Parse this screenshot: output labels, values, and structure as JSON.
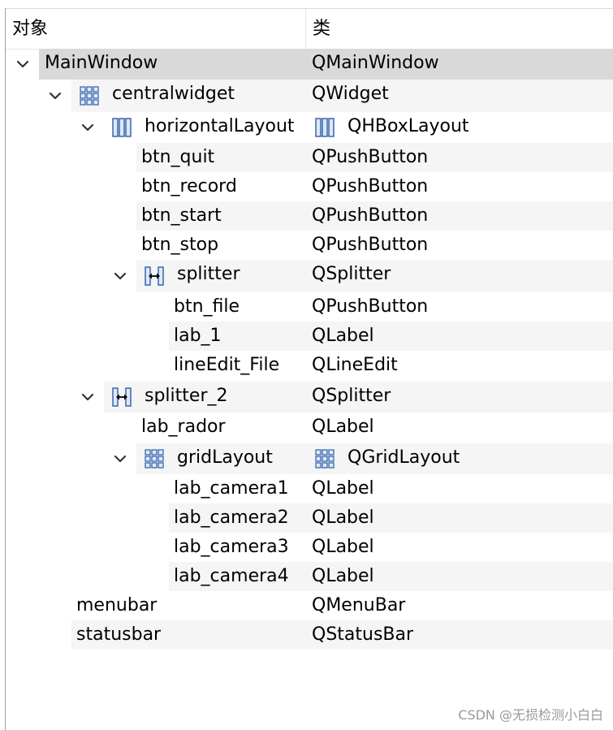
{
  "header": {
    "object_col": "对象",
    "class_col": "类"
  },
  "rows": [
    {
      "name": "MainWindow",
      "cls": "QMainWindow",
      "depth": 0,
      "expand": true,
      "icon": "",
      "cls_icon": "",
      "selected": true
    },
    {
      "name": "centralwidget",
      "cls": "QWidget",
      "depth": 1,
      "expand": true,
      "icon": "grid-layout-icon",
      "cls_icon": ""
    },
    {
      "name": "horizontalLayout",
      "cls": "QHBoxLayout",
      "depth": 2,
      "expand": true,
      "icon": "hbox-layout-icon",
      "cls_icon": "hbox-layout-icon"
    },
    {
      "name": "btn_quit",
      "cls": "QPushButton",
      "depth": 3,
      "expand": false,
      "icon": "",
      "cls_icon": ""
    },
    {
      "name": "btn_record",
      "cls": "QPushButton",
      "depth": 3,
      "expand": false,
      "icon": "",
      "cls_icon": ""
    },
    {
      "name": "btn_start",
      "cls": "QPushButton",
      "depth": 3,
      "expand": false,
      "icon": "",
      "cls_icon": ""
    },
    {
      "name": "btn_stop",
      "cls": "QPushButton",
      "depth": 3,
      "expand": false,
      "icon": "",
      "cls_icon": ""
    },
    {
      "name": "splitter",
      "cls": "QSplitter",
      "depth": 3,
      "expand": true,
      "icon": "splitter-icon",
      "cls_icon": ""
    },
    {
      "name": "btn_file",
      "cls": "QPushButton",
      "depth": 4,
      "expand": false,
      "icon": "",
      "cls_icon": ""
    },
    {
      "name": "lab_1",
      "cls": "QLabel",
      "depth": 4,
      "expand": false,
      "icon": "",
      "cls_icon": ""
    },
    {
      "name": "lineEdit_File",
      "cls": "QLineEdit",
      "depth": 4,
      "expand": false,
      "icon": "",
      "cls_icon": ""
    },
    {
      "name": "splitter_2",
      "cls": "QSplitter",
      "depth": 2,
      "expand": true,
      "icon": "splitter-icon",
      "cls_icon": ""
    },
    {
      "name": "lab_rador",
      "cls": "QLabel",
      "depth": 3,
      "expand": false,
      "icon": "",
      "cls_icon": ""
    },
    {
      "name": "gridLayout",
      "cls": "QGridLayout",
      "depth": 3,
      "expand": true,
      "icon": "grid-layout-icon",
      "cls_icon": "grid-layout-icon"
    },
    {
      "name": "lab_camera1",
      "cls": "QLabel",
      "depth": 4,
      "expand": false,
      "icon": "",
      "cls_icon": ""
    },
    {
      "name": "lab_camera2",
      "cls": "QLabel",
      "depth": 4,
      "expand": false,
      "icon": "",
      "cls_icon": ""
    },
    {
      "name": "lab_camera3",
      "cls": "QLabel",
      "depth": 4,
      "expand": false,
      "icon": "",
      "cls_icon": ""
    },
    {
      "name": "lab_camera4",
      "cls": "QLabel",
      "depth": 4,
      "expand": false,
      "icon": "",
      "cls_icon": ""
    },
    {
      "name": "menubar",
      "cls": "QMenuBar",
      "depth": 1,
      "expand": false,
      "icon": "",
      "cls_icon": ""
    },
    {
      "name": "statusbar",
      "cls": "QStatusBar",
      "depth": 1,
      "expand": false,
      "icon": "",
      "cls_icon": ""
    }
  ],
  "colors": {
    "selected": "#d9d9d9",
    "alternate": "#f5f5f5",
    "text": "#000000",
    "icon_blue": "#2a5caa"
  },
  "watermark": "CSDN @无损检测小白白"
}
